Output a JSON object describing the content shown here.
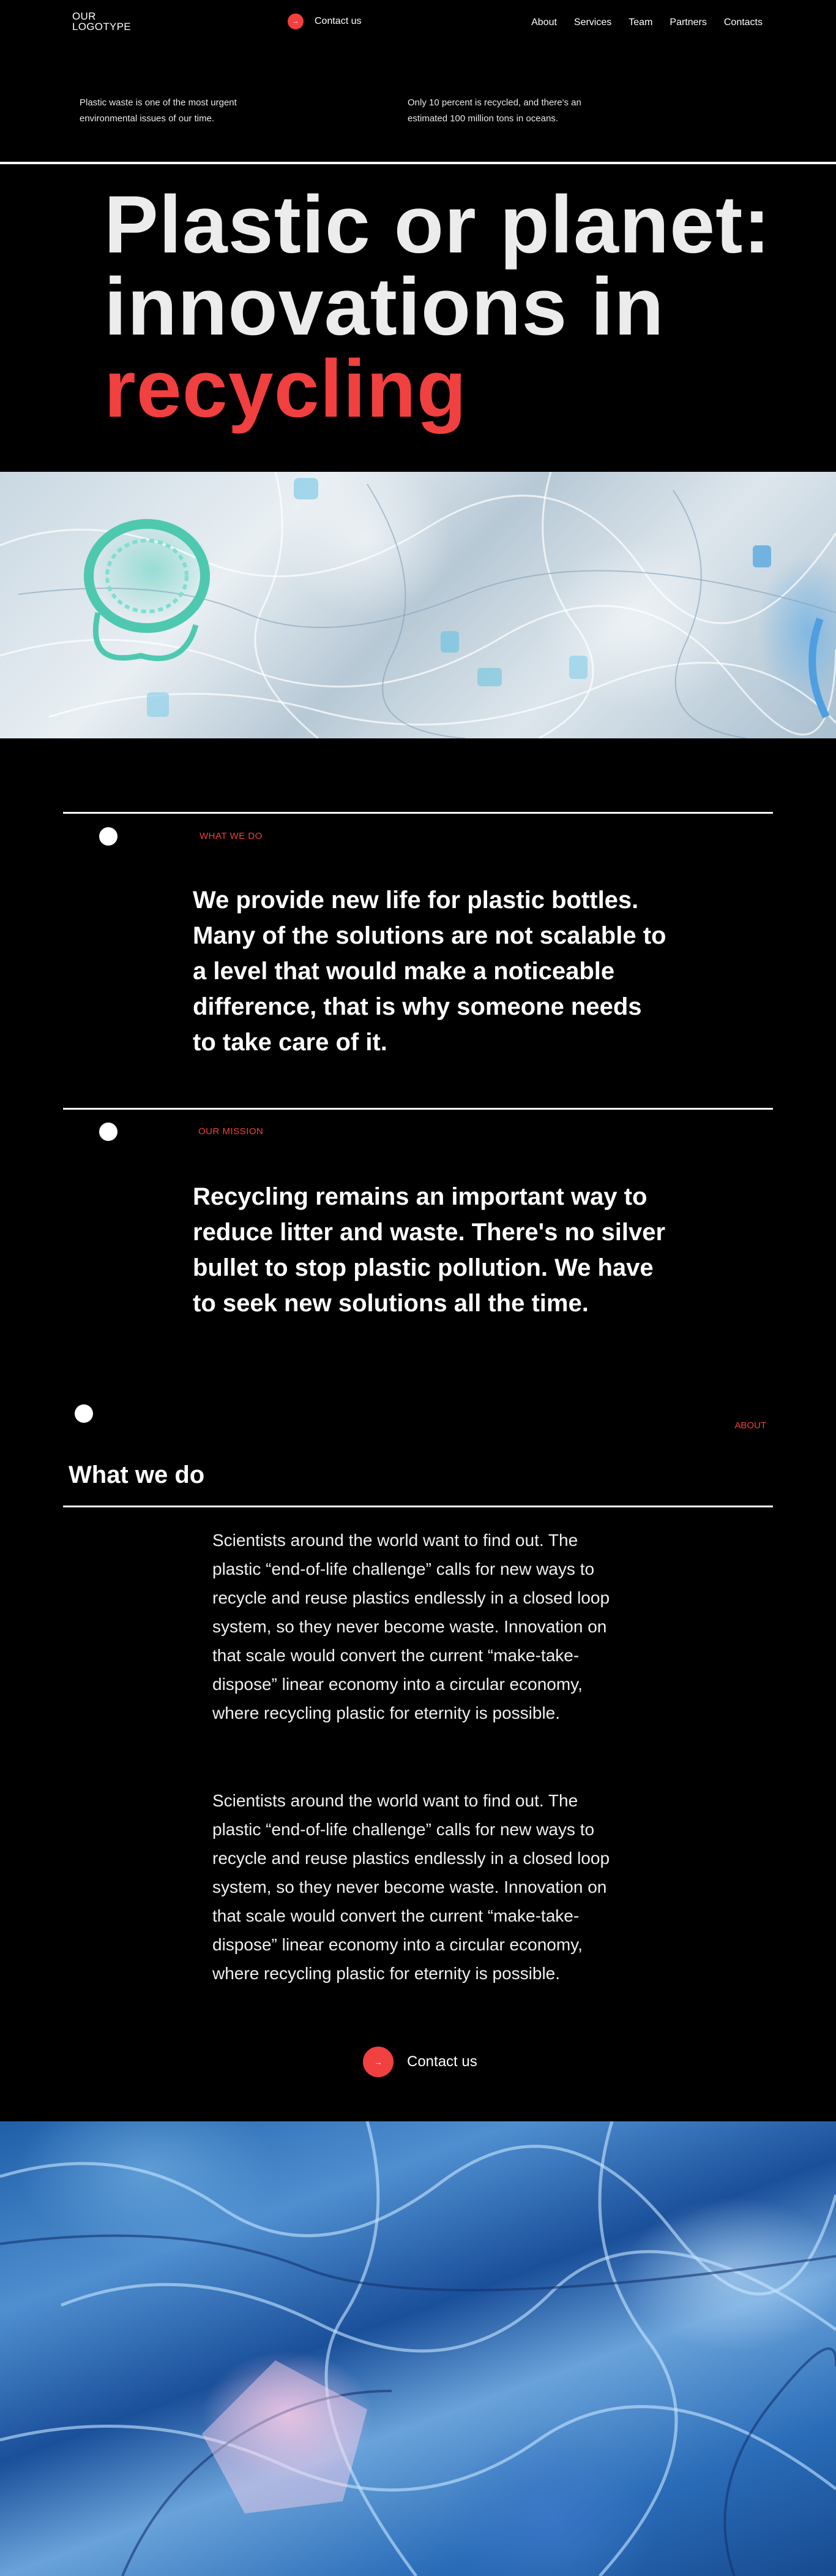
{
  "header": {
    "logo_line1": "OUR",
    "logo_line2": "LOGOTYPE",
    "cta_label": "Contact us",
    "cta_icon": "arrow-icon",
    "nav": [
      "About",
      "Services",
      "Team",
      "Partners",
      "Contacts"
    ]
  },
  "intro": {
    "left": "Plastic waste is one of the most urgent environmental issues of our time.",
    "right": "Only 10 percent is recycled, and there's an estimated 100 million tons in oceans."
  },
  "hero": {
    "line1": "Plastic or planet:",
    "line2": "innovations in",
    "line3": "recycling"
  },
  "what_we_do": {
    "kicker": "WHAT WE DO",
    "text": "We provide new life for plastic bottles. Many of the solutions are not scalable to a level that would make a noticeable difference, that is why someone needs to take care of it."
  },
  "mission": {
    "kicker": "OUR MISSION",
    "text": "Recycling remains an important way to reduce litter and waste. There's no silver bullet to stop plastic pollution. We have to seek new solutions all the time."
  },
  "about": {
    "kicker": "ABOUT",
    "title": "What we do",
    "paragraph1": "Scientists around the world want to find out. The plastic “end-of-life challenge” calls for new ways to recycle and reuse plastics endlessly in a closed loop system, so they never become waste. Innovation on that scale would convert the current “make-take-dispose” linear economy into a circular economy, where recycling plastic for eternity is possible.",
    "paragraph2": "Scientists around the world want to find out. The plastic “end-of-life challenge” calls for new ways to recycle and reuse plastics endlessly in a closed loop system, so they never become waste. Innovation on that scale would convert the current “make-take-dispose” linear economy into a circular economy, where recycling plastic for eternity is possible.",
    "cta_label": "Contact us"
  },
  "colors": {
    "accent": "#f0403f",
    "background": "#000000",
    "text": "#ffffff"
  }
}
